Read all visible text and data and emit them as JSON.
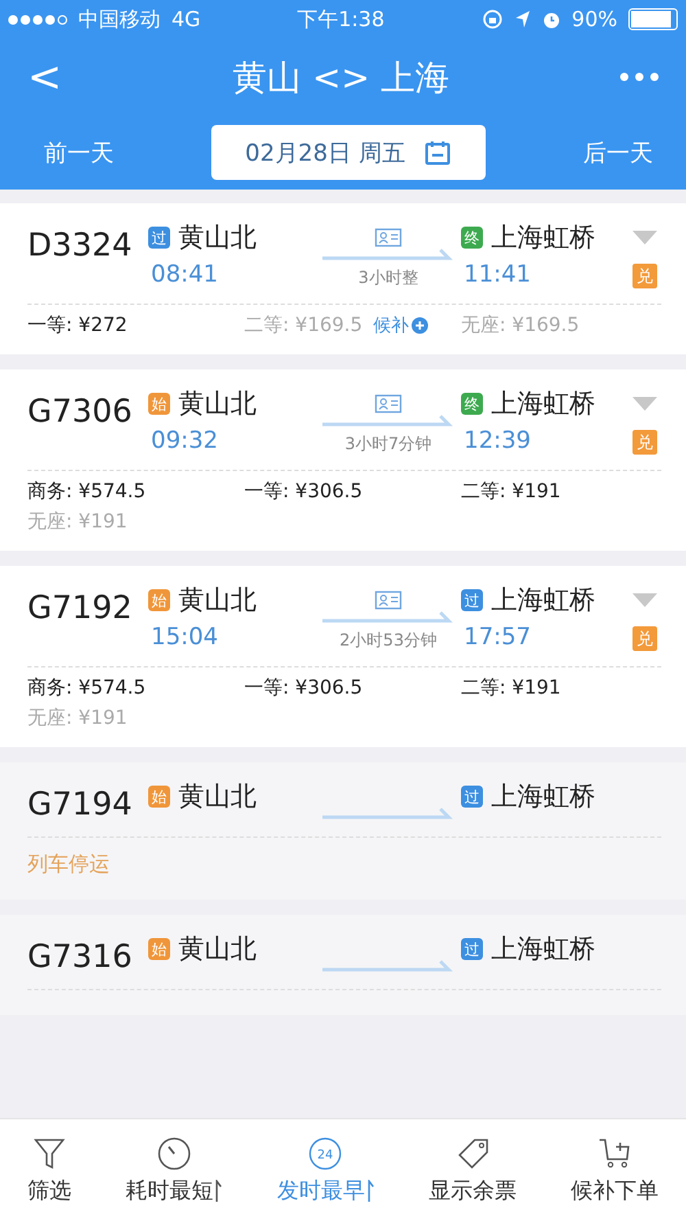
{
  "status_bar": {
    "carrier": "中国移动",
    "network": "4G",
    "time": "下午1:38",
    "battery": "90%"
  },
  "header": {
    "back": "<",
    "title": "黄山 <> 上海"
  },
  "date_bar": {
    "prev": "前一天",
    "date": "02月28日 周五",
    "next": "后一天"
  },
  "trains": [
    {
      "kind": "normal",
      "number": "D3324",
      "from": {
        "badge": "过",
        "color": "#3d8fe0",
        "name": "黄山北",
        "time": "08:41"
      },
      "duration": "3小时整",
      "to": {
        "badge": "终",
        "color": "#3daa4f",
        "name": "上海虹桥",
        "time": "11:41"
      },
      "exchange": "兑",
      "seats": [
        {
          "label": "一等:",
          "price": "¥272",
          "available": true
        },
        {
          "label": "二等:",
          "price": "¥169.5",
          "available": false,
          "waitlist": "候补"
        },
        {
          "label": "无座:",
          "price": "¥169.5",
          "available": false
        }
      ]
    },
    {
      "kind": "normal",
      "number": "G7306",
      "from": {
        "badge": "始",
        "color": "#f0963a",
        "name": "黄山北",
        "time": "09:32"
      },
      "duration": "3小时7分钟",
      "to": {
        "badge": "终",
        "color": "#3daa4f",
        "name": "上海虹桥",
        "time": "12:39"
      },
      "exchange": "兑",
      "seats": [
        {
          "label": "商务:",
          "price": "¥574.5",
          "available": true
        },
        {
          "label": "一等:",
          "price": "¥306.5",
          "available": true
        },
        {
          "label": "二等:",
          "price": "¥191",
          "available": true
        },
        {
          "label": "无座:",
          "price": "¥191",
          "available": false
        }
      ]
    },
    {
      "kind": "normal",
      "number": "G7192",
      "from": {
        "badge": "始",
        "color": "#f0963a",
        "name": "黄山北",
        "time": "15:04"
      },
      "duration": "2小时53分钟",
      "to": {
        "badge": "过",
        "color": "#3d8fe0",
        "name": "上海虹桥",
        "time": "17:57"
      },
      "exchange": "兑",
      "seats": [
        {
          "label": "商务:",
          "price": "¥574.5",
          "available": true
        },
        {
          "label": "一等:",
          "price": "¥306.5",
          "available": true
        },
        {
          "label": "二等:",
          "price": "¥191",
          "available": true
        },
        {
          "label": "无座:",
          "price": "¥191",
          "available": false
        }
      ]
    },
    {
      "kind": "suspended",
      "number": "G7194",
      "from": {
        "badge": "始",
        "color": "#f0963a",
        "name": "黄山北"
      },
      "to": {
        "badge": "过",
        "color": "#3d8fe0",
        "name": "上海虹桥"
      },
      "status": "列车停运"
    },
    {
      "kind": "suspended",
      "number": "G7316",
      "from": {
        "badge": "始",
        "color": "#f0963a",
        "name": "黄山北"
      },
      "to": {
        "badge": "过",
        "color": "#3d8fe0",
        "name": "上海虹桥"
      }
    }
  ],
  "tab_bar": [
    {
      "kind": "filter",
      "label": "筛选",
      "selected": false
    },
    {
      "kind": "duration",
      "label": "耗时最短",
      "selected": false,
      "sortable": true
    },
    {
      "kind": "clock24",
      "label": "发时最早",
      "selected": true,
      "sortable": true,
      "icon_text": "24"
    },
    {
      "kind": "tag",
      "label": "显示余票",
      "selected": false
    },
    {
      "kind": "cart",
      "label": "候补下单",
      "selected": false
    }
  ]
}
